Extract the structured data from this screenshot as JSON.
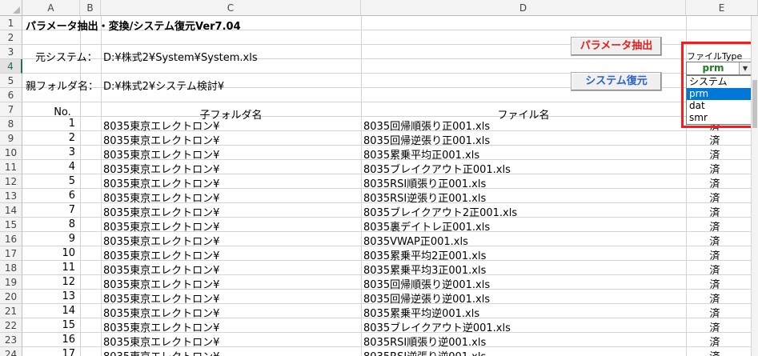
{
  "columns": [
    {
      "label": "A"
    },
    {
      "label": "B"
    },
    {
      "label": "C"
    },
    {
      "label": "D"
    },
    {
      "label": "E"
    }
  ],
  "row_numbers": [
    "1",
    "2",
    "3",
    "4",
    "5",
    "6",
    "7",
    "8",
    "9",
    "10",
    "11",
    "12",
    "13",
    "14",
    "15",
    "16",
    "17",
    "18",
    "19",
    "20",
    "21",
    "22",
    "23",
    "24"
  ],
  "selected_row": "4",
  "header": {
    "title": "パラメータ抽出・変換/システム復元Ver7.04",
    "source_label": "元システム：",
    "source_path": "D:¥株式2¥System¥System.xls",
    "parent_label": "親フォルダ名：",
    "parent_path": "D:¥株式2¥システム検討¥"
  },
  "buttons": {
    "extract": "パラメータ抽出",
    "restore": "システム復元"
  },
  "dropdown": {
    "label": "ファイルType",
    "value": "prm",
    "options": [
      "システム",
      "prm",
      "dat",
      "smr"
    ],
    "selected_index": 1
  },
  "table": {
    "headers": {
      "no": "No.",
      "subfolder": "子フォルダ名",
      "filename": "ファイル名"
    },
    "rows": [
      {
        "no": "1",
        "folder": "8035東京エレクトロン¥",
        "file": "8035回帰順張り正001.xls",
        "status": "済"
      },
      {
        "no": "2",
        "folder": "8035東京エレクトロン¥",
        "file": "8035回帰逆張り正001.xls",
        "status": "済"
      },
      {
        "no": "3",
        "folder": "8035東京エレクトロン¥",
        "file": "8035累乗平均正001.xls",
        "status": "済"
      },
      {
        "no": "4",
        "folder": "8035東京エレクトロン¥",
        "file": "8035ブレイクアウト正001.xls",
        "status": "済"
      },
      {
        "no": "5",
        "folder": "8035東京エレクトロン¥",
        "file": "8035RSI順張り正001.xls",
        "status": "済"
      },
      {
        "no": "6",
        "folder": "8035東京エレクトロン¥",
        "file": "8035RSI逆張り正001.xls",
        "status": "済"
      },
      {
        "no": "7",
        "folder": "8035東京エレクトロン¥",
        "file": "8035ブレイクアウト2正001.xls",
        "status": "済"
      },
      {
        "no": "8",
        "folder": "8035東京エレクトロン¥",
        "file": "8035裏デイトレ正001.xls",
        "status": "済"
      },
      {
        "no": "9",
        "folder": "8035東京エレクトロン¥",
        "file": "8035VWAP正001.xls",
        "status": "済"
      },
      {
        "no": "10",
        "folder": "8035東京エレクトロン¥",
        "file": "8035累乗平均2正001.xls",
        "status": "済"
      },
      {
        "no": "11",
        "folder": "8035東京エレクトロン¥",
        "file": "8035累乗平均3正001.xls",
        "status": "済"
      },
      {
        "no": "12",
        "folder": "8035東京エレクトロン¥",
        "file": "8035回帰順張り逆001.xls",
        "status": "済"
      },
      {
        "no": "13",
        "folder": "8035東京エレクトロン¥",
        "file": "8035回帰逆張り逆001.xls",
        "status": "済"
      },
      {
        "no": "14",
        "folder": "8035東京エレクトロン¥",
        "file": "8035累乗平均逆001.xls",
        "status": "済"
      },
      {
        "no": "15",
        "folder": "8035東京エレクトロン¥",
        "file": "8035ブレイクアウト逆001.xls",
        "status": "済"
      },
      {
        "no": "16",
        "folder": "8035東京エレクトロン¥",
        "file": "8035RSI順張り逆001.xls",
        "status": "済"
      },
      {
        "no": "17",
        "folder": "8035東京エレクトロン¥",
        "file": "8035RSI逆張り逆001.xls",
        "status": "済"
      }
    ]
  },
  "colors": {
    "button_red": "#e01e1e",
    "button_blue": "#2e63c6",
    "highlight_box": "#ff1a1a",
    "dropdown_value": "#1e7d1e",
    "selection": "#0078d7"
  }
}
